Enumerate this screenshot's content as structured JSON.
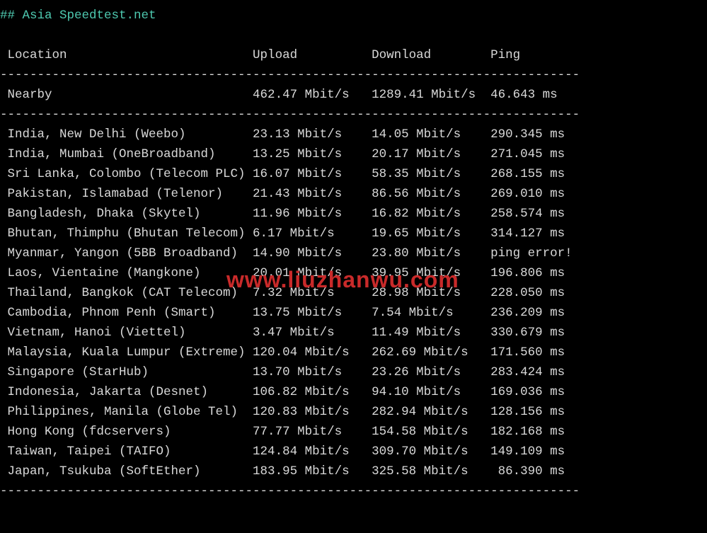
{
  "title": "## Asia Speedtest.net",
  "headers": {
    "c1": " Location",
    "c2": "Upload",
    "c3": "Download",
    "c4": "Ping"
  },
  "nearby": {
    "c1": " Nearby",
    "c2": "462.47 Mbit/s",
    "c3": "1289.41 Mbit/s",
    "c4": "46.643 ms"
  },
  "rows": [
    {
      "c1": " India, New Delhi (Weebo)",
      "c2": "23.13 Mbit/s",
      "c3": "14.05 Mbit/s",
      "c4": "290.345 ms"
    },
    {
      "c1": " India, Mumbai (OneBroadband)",
      "c2": "13.25 Mbit/s",
      "c3": "20.17 Mbit/s",
      "c4": "271.045 ms"
    },
    {
      "c1": " Sri Lanka, Colombo (Telecom PLC)",
      "c2": "16.07 Mbit/s",
      "c3": "58.35 Mbit/s",
      "c4": "268.155 ms"
    },
    {
      "c1": " Pakistan, Islamabad (Telenor)",
      "c2": "21.43 Mbit/s",
      "c3": "86.56 Mbit/s",
      "c4": "269.010 ms"
    },
    {
      "c1": " Bangladesh, Dhaka (Skytel)",
      "c2": "11.96 Mbit/s",
      "c3": "16.82 Mbit/s",
      "c4": "258.574 ms"
    },
    {
      "c1": " Bhutan, Thimphu (Bhutan Telecom)",
      "c2": "6.17 Mbit/s",
      "c3": "19.65 Mbit/s",
      "c4": "314.127 ms"
    },
    {
      "c1": " Myanmar, Yangon (5BB Broadband)",
      "c2": "14.90 Mbit/s",
      "c3": "23.80 Mbit/s",
      "c4": "ping error!"
    },
    {
      "c1": " Laos, Vientaine (Mangkone)",
      "c2": "20.01 Mbit/s",
      "c3": "39.95 Mbit/s",
      "c4": "196.806 ms"
    },
    {
      "c1": " Thailand, Bangkok (CAT Telecom)",
      "c2": "7.32 Mbit/s",
      "c3": "28.98 Mbit/s",
      "c4": "228.050 ms"
    },
    {
      "c1": " Cambodia, Phnom Penh (Smart)",
      "c2": "13.75 Mbit/s",
      "c3": "7.54 Mbit/s",
      "c4": "236.209 ms"
    },
    {
      "c1": " Vietnam, Hanoi (Viettel)",
      "c2": "3.47 Mbit/s",
      "c3": "11.49 Mbit/s",
      "c4": "330.679 ms"
    },
    {
      "c1": " Malaysia, Kuala Lumpur (Extreme)",
      "c2": "120.04 Mbit/s",
      "c3": "262.69 Mbit/s",
      "c4": "171.560 ms"
    },
    {
      "c1": " Singapore (StarHub)",
      "c2": "13.70 Mbit/s",
      "c3": "23.26 Mbit/s",
      "c4": "283.424 ms"
    },
    {
      "c1": " Indonesia, Jakarta (Desnet)",
      "c2": "106.82 Mbit/s",
      "c3": "94.10 Mbit/s",
      "c4": "169.036 ms"
    },
    {
      "c1": " Philippines, Manila (Globe Tel)",
      "c2": "120.83 Mbit/s",
      "c3": "282.94 Mbit/s",
      "c4": "128.156 ms"
    },
    {
      "c1": " Hong Kong (fdcservers)",
      "c2": "77.77 Mbit/s",
      "c3": "154.58 Mbit/s",
      "c4": "182.168 ms"
    },
    {
      "c1": " Taiwan, Taipei (TAIFO)",
      "c2": "124.84 Mbit/s",
      "c3": "309.70 Mbit/s",
      "c4": "149.109 ms"
    },
    {
      "c1": " Japan, Tsukuba (SoftEther)",
      "c2": "183.95 Mbit/s",
      "c3": "325.58 Mbit/s",
      "c4": " 86.390 ms"
    }
  ],
  "watermark": "www.liuzhanwu.com",
  "chart_data": {
    "type": "table",
    "title": "Asia Speedtest.net",
    "columns": [
      "Location",
      "Upload",
      "Download",
      "Ping"
    ],
    "units": [
      "",
      "Mbit/s",
      "Mbit/s",
      "ms"
    ],
    "nearby": {
      "location": "Nearby",
      "upload": 462.47,
      "download": 1289.41,
      "ping": 46.643
    },
    "entries": [
      {
        "location": "India, New Delhi (Weebo)",
        "upload": 23.13,
        "download": 14.05,
        "ping": 290.345
      },
      {
        "location": "India, Mumbai (OneBroadband)",
        "upload": 13.25,
        "download": 20.17,
        "ping": 271.045
      },
      {
        "location": "Sri Lanka, Colombo (Telecom PLC)",
        "upload": 16.07,
        "download": 58.35,
        "ping": 268.155
      },
      {
        "location": "Pakistan, Islamabad (Telenor)",
        "upload": 21.43,
        "download": 86.56,
        "ping": 269.01
      },
      {
        "location": "Bangladesh, Dhaka (Skytel)",
        "upload": 11.96,
        "download": 16.82,
        "ping": 258.574
      },
      {
        "location": "Bhutan, Thimphu (Bhutan Telecom)",
        "upload": 6.17,
        "download": 19.65,
        "ping": 314.127
      },
      {
        "location": "Myanmar, Yangon (5BB Broadband)",
        "upload": 14.9,
        "download": 23.8,
        "ping": null,
        "ping_text": "ping error!"
      },
      {
        "location": "Laos, Vientaine (Mangkone)",
        "upload": 20.01,
        "download": 39.95,
        "ping": 196.806
      },
      {
        "location": "Thailand, Bangkok (CAT Telecom)",
        "upload": 7.32,
        "download": 28.98,
        "ping": 228.05
      },
      {
        "location": "Cambodia, Phnom Penh (Smart)",
        "upload": 13.75,
        "download": 7.54,
        "ping": 236.209
      },
      {
        "location": "Vietnam, Hanoi (Viettel)",
        "upload": 3.47,
        "download": 11.49,
        "ping": 330.679
      },
      {
        "location": "Malaysia, Kuala Lumpur (Extreme)",
        "upload": 120.04,
        "download": 262.69,
        "ping": 171.56
      },
      {
        "location": "Singapore (StarHub)",
        "upload": 13.7,
        "download": 23.26,
        "ping": 283.424
      },
      {
        "location": "Indonesia, Jakarta (Desnet)",
        "upload": 106.82,
        "download": 94.1,
        "ping": 169.036
      },
      {
        "location": "Philippines, Manila (Globe Tel)",
        "upload": 120.83,
        "download": 282.94,
        "ping": 128.156
      },
      {
        "location": "Hong Kong (fdcservers)",
        "upload": 77.77,
        "download": 154.58,
        "ping": 182.168
      },
      {
        "location": "Taiwan, Taipei (TAIFO)",
        "upload": 124.84,
        "download": 309.7,
        "ping": 149.109
      },
      {
        "location": "Japan, Tsukuba (SoftEther)",
        "upload": 183.95,
        "download": 325.58,
        "ping": 86.39
      }
    ]
  }
}
